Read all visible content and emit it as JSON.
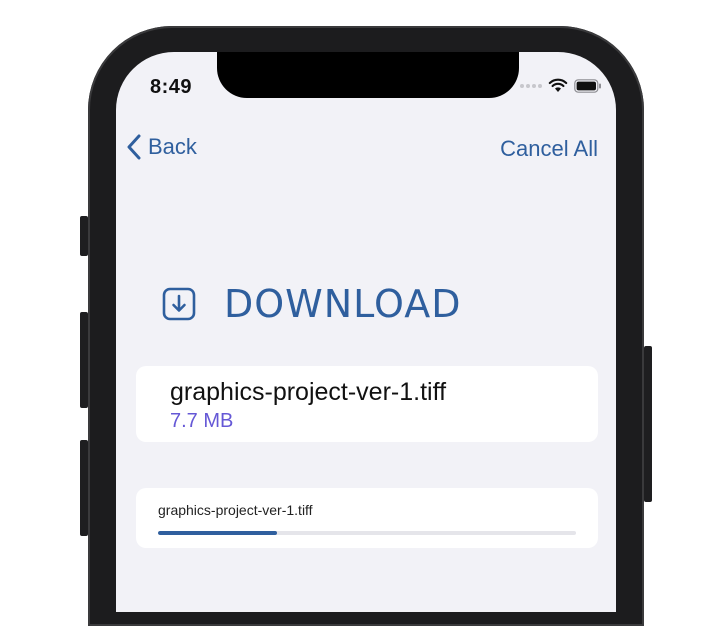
{
  "status_bar": {
    "time": "8:49"
  },
  "nav": {
    "back_label": "Back",
    "cancel_all_label": "Cancel All"
  },
  "heading": {
    "title": "DOWNLOAD",
    "icon": "download-box-icon"
  },
  "file": {
    "name": "graphics-project-ver-1.tiff",
    "size": "7.7 MB"
  },
  "progress": {
    "label": "graphics-project-ver-1.tiff",
    "fraction": 0.285
  },
  "colors": {
    "accent": "#2f5f9e",
    "size_text": "#6558d6",
    "background": "#f2f2f7"
  }
}
